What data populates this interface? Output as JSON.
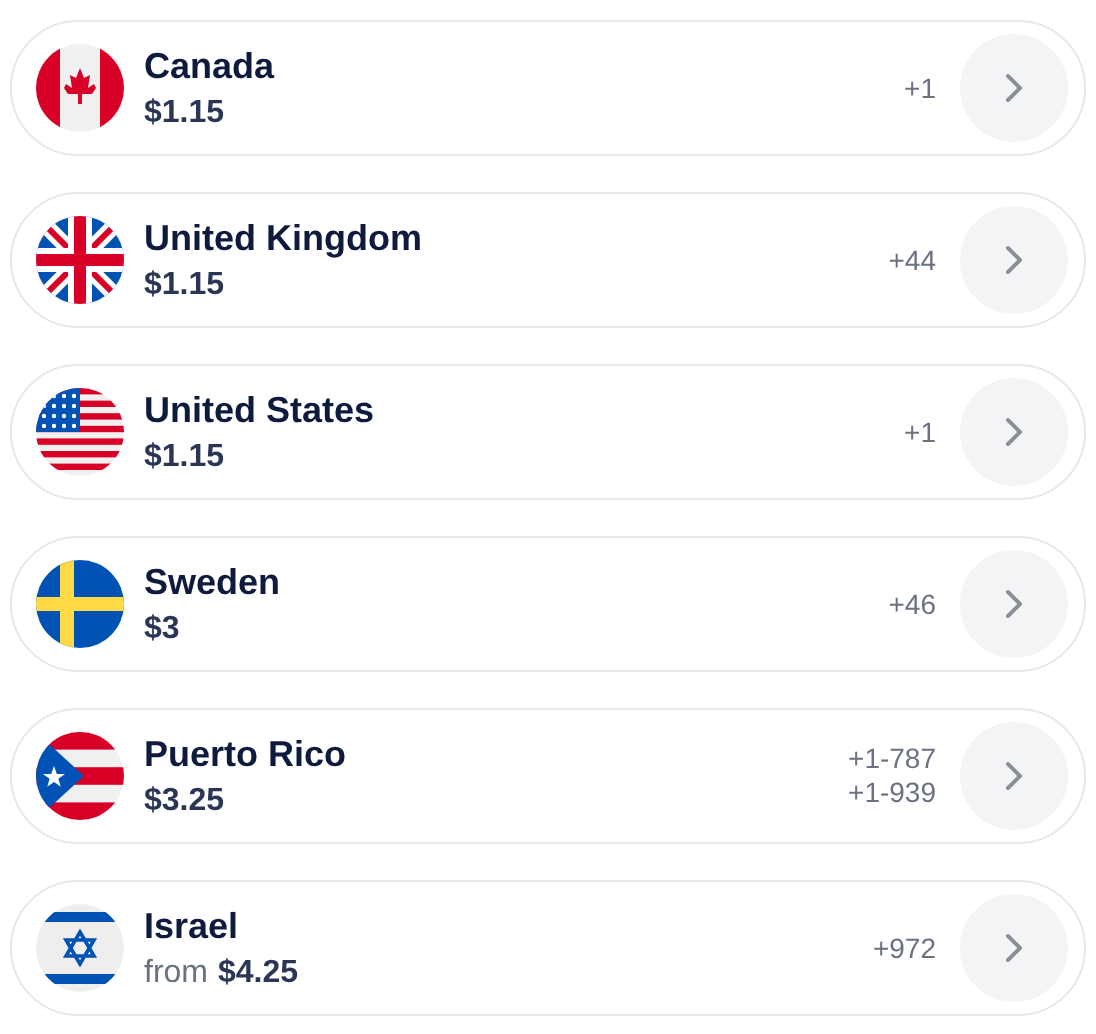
{
  "countries": [
    {
      "kind": "canada",
      "name": "Canada",
      "price": "$1.15",
      "codes": [
        "+1"
      ]
    },
    {
      "kind": "uk",
      "name": "United Kingdom",
      "price": "$1.15",
      "codes": [
        "+44"
      ]
    },
    {
      "kind": "us",
      "name": "United States",
      "price": "$1.15",
      "codes": [
        "+1"
      ]
    },
    {
      "kind": "sweden",
      "name": "Sweden",
      "price": "$3",
      "codes": [
        "+46"
      ]
    },
    {
      "kind": "puertorico",
      "name": "Puerto Rico",
      "price": "$3.25",
      "codes": [
        "+1-787",
        "+1-939"
      ]
    },
    {
      "kind": "israel",
      "name": "Israel",
      "price_prefix": "from",
      "price": "$4.25",
      "codes": [
        "+972"
      ]
    }
  ]
}
